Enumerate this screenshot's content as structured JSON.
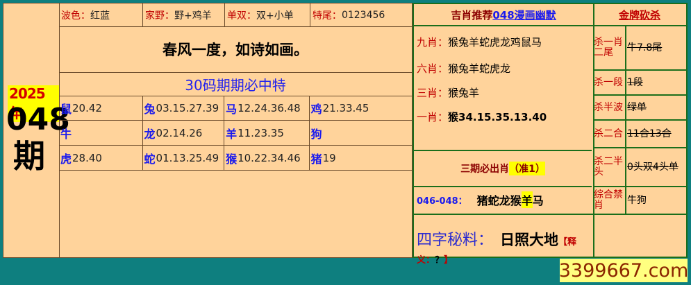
{
  "left": {
    "year": "2025年",
    "issue": "048",
    "qi": "期",
    "top_row": [
      {
        "label": "波色：",
        "value": "红蓝"
      },
      {
        "label": "家野：",
        "value": "野+鸡羊"
      },
      {
        "label": "单双：",
        "value": "双+小单"
      },
      {
        "label": "特尾：",
        "value": "0123456"
      }
    ],
    "poem": "春风一度，如诗如画。",
    "te_title": "30码期期必中特",
    "zodiac": [
      [
        {
          "z": "鼠",
          "n": "20.42"
        },
        {
          "z": "兔",
          "n": "03.15.27.39"
        },
        {
          "z": "马",
          "n": "12.24.36.48"
        },
        {
          "z": "鸡",
          "n": "21.33.45"
        }
      ],
      [
        {
          "z": "牛",
          "n": ""
        },
        {
          "z": "龙",
          "n": "02.14.26"
        },
        {
          "z": "羊",
          "n": "11.23.35"
        },
        {
          "z": "狗",
          "n": ""
        }
      ],
      [
        {
          "z": "虎",
          "n": "28.40"
        },
        {
          "z": "蛇",
          "n": "01.13.25.49"
        },
        {
          "z": "猴",
          "n": "10.22.34.46"
        },
        {
          "z": "猪",
          "n": "19"
        }
      ]
    ]
  },
  "right": {
    "head_prefix": "吉肖推荐",
    "head_link": "048漫画幽默",
    "kill_title": "金牌砍杀",
    "shio": [
      {
        "label": "九肖：",
        "value": "猴兔羊蛇虎龙鸡鼠马"
      },
      {
        "label": "六肖：",
        "value": "猴兔羊蛇虎龙"
      },
      {
        "label": "三肖：",
        "value": "猴兔羊"
      },
      {
        "label": "一肖：",
        "value": "猴34.15.35.13.40"
      }
    ],
    "sanqi": "三期必出肖",
    "sanqi_zhun": "（准1）",
    "range_label": "046-048：",
    "range_a": "猪蛇龙猴",
    "range_hi": "羊",
    "range_b": "马",
    "secret_label": "四字秘料：",
    "secret_value": "日照大地",
    "secret_note_l": "【释义：",
    "secret_note_q": "？",
    "secret_note_r": "】",
    "kills": [
      {
        "label": "杀一肖二尾",
        "value": "牛7.8尾"
      },
      {
        "label": "杀一段",
        "value": "1段"
      },
      {
        "label": "杀半波",
        "value": "绿单"
      },
      {
        "label": "杀二合",
        "value": "11合13合"
      },
      {
        "label": "杀二半头",
        "value": "0头双4头单"
      },
      {
        "label": "综合禁肖",
        "value": "牛狗"
      }
    ]
  },
  "watermark": "3399667.com"
}
